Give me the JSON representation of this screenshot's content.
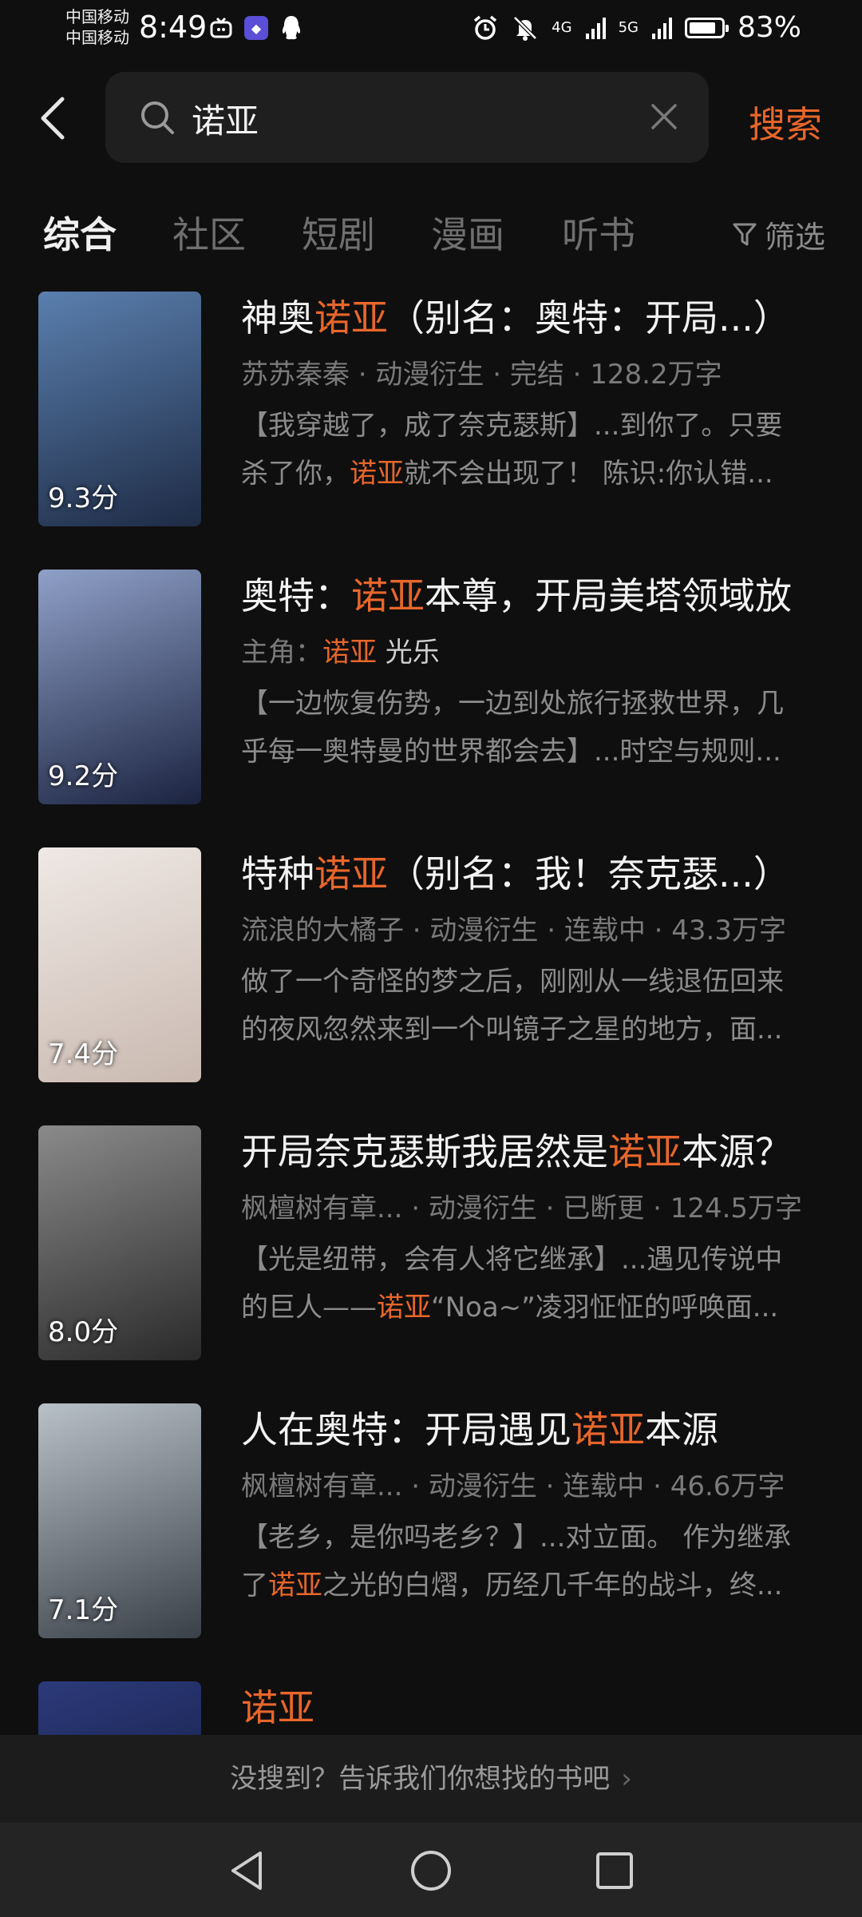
{
  "status_bar": {
    "carrier_1": "中国移动",
    "carrier_2": "中国移动",
    "time": "8:49",
    "signal_1": "4G",
    "signal_2": "5G",
    "battery_percent": "83%",
    "battery_level": 0.83
  },
  "search": {
    "query": "诺亚",
    "submit_label": "搜索"
  },
  "tabs": [
    "综合",
    "社区",
    "短剧",
    "漫画",
    "听书"
  ],
  "active_tab": 0,
  "filter_label": "筛选",
  "results": [
    {
      "title_parts": [
        "神奥",
        "诺亚",
        "（别名：奥特：开局...）"
      ],
      "meta_parts": [
        "苏苏秦秦 · 动漫衍生 · 完结 · 128.2万字"
      ],
      "desc_line1": [
        "【我穿越了，成了奈克瑟斯】...到你了。只要"
      ],
      "desc_line2": [
        "杀了你，",
        "诺亚",
        "就不会出现了！ 陈识:你认错..."
      ],
      "score": "9.3分",
      "cover_colors": [
        "#5a7fae",
        "#1e2b45"
      ]
    },
    {
      "title_parts": [
        "奥特：",
        "诺亚",
        "本尊，开局美塔领域放"
      ],
      "meta_parts": [
        "主角：",
        "诺亚",
        " 光乐"
      ],
      "desc_line1": [
        "【一边恢复伤势，一边到处旅行拯救世界，几"
      ],
      "desc_line2": [
        "乎每一奥特曼的世界都会去】...时空与规则..."
      ],
      "score": "9.2分",
      "cover_colors": [
        "#8fa0c8",
        "#1b2340"
      ]
    },
    {
      "title_parts": [
        "特种",
        "诺亚",
        "（别名：我！奈克瑟...）"
      ],
      "meta_parts": [
        "流浪的大橘子 · 动漫衍生 · 连载中 · 43.3万字"
      ],
      "desc_line1": [
        "做了一个奇怪的梦之后，刚刚从一线退伍回来"
      ],
      "desc_line2": [
        "的夜风忽然来到一个叫镜子之星的地方，面..."
      ],
      "score": "7.4分",
      "cover_colors": [
        "#efe8e4",
        "#c9b9b0"
      ]
    },
    {
      "title_parts": [
        "开局奈克瑟斯我居然是",
        "诺亚",
        "本源？"
      ],
      "meta_parts": [
        "枫檀树有章...  · 动漫衍生 · 已断更 · 124.5万字"
      ],
      "desc_line1": [
        "【光是纽带，会有人将它继承】...遇见传说中"
      ],
      "desc_line2": [
        "的巨人——",
        "诺亚",
        "“Noa~”凌羽怔怔的呼唤面..."
      ],
      "score": "8.0分",
      "cover_colors": [
        "#8a8a8a",
        "#2a2a2a"
      ]
    },
    {
      "title_parts": [
        "人在奥特：开局遇见",
        "诺亚",
        "本源"
      ],
      "meta_parts": [
        "枫檀树有章...   · 动漫衍生 · 连载中 · 46.6万字"
      ],
      "desc_line1": [
        "【老乡，是你吗老乡？】...对立面。 作为继承"
      ],
      "desc_line2": [
        "了",
        "诺亚",
        "之光的白熠，历经几千年的战斗，终..."
      ],
      "score": "7.1分",
      "cover_colors": [
        "#b8c0c8",
        "#3a4048"
      ]
    },
    {
      "title_parts": [
        "",
        "诺亚",
        ""
      ],
      "cover_colors": [
        "#2c3a7a",
        "#0c1230"
      ]
    }
  ],
  "feedback_prompt": "没搜到？告诉我们你想找的书吧",
  "colors": {
    "accent": "#e8662b",
    "background": "#0f0f0f"
  },
  "icons": {
    "back": "back-arrow-icon",
    "search": "search-icon",
    "clear": "clear-icon",
    "filter": "filter-icon",
    "nav_back": "nav-back-icon",
    "nav_home": "nav-home-icon",
    "nav_recent": "nav-recent-icon"
  }
}
